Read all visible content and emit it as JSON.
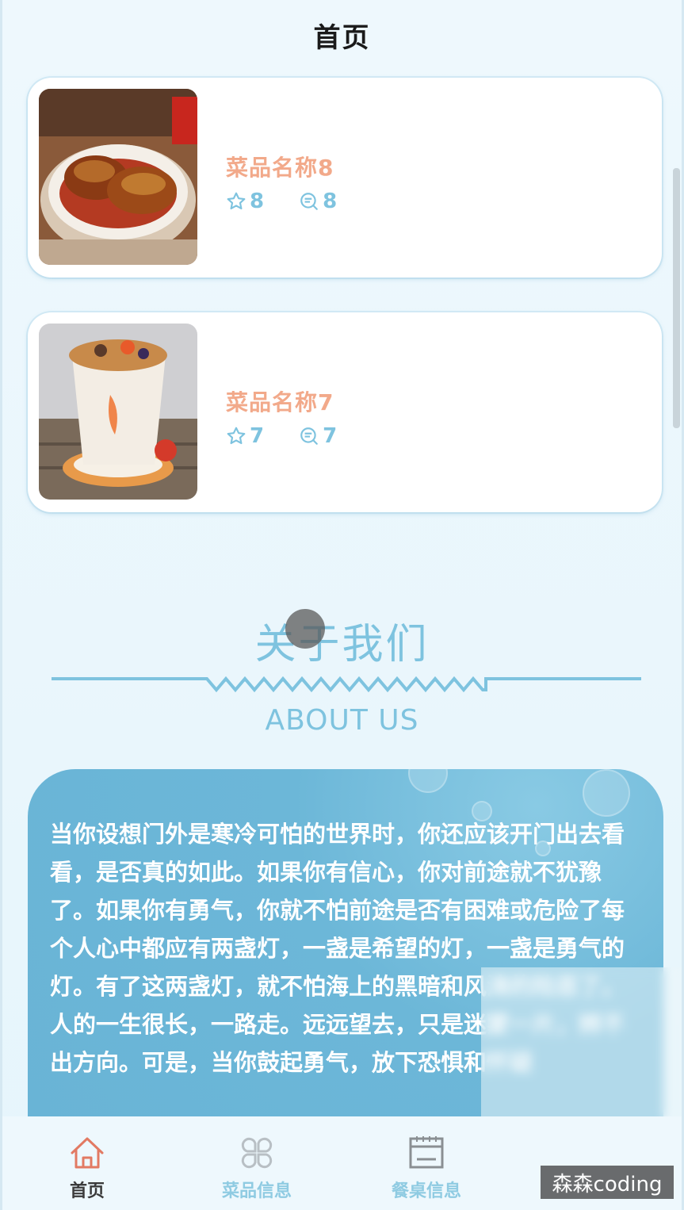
{
  "header": {
    "title": "首页"
  },
  "dishes": [
    {
      "name": "菜品名称8",
      "likes": "8",
      "comments": "8"
    },
    {
      "name": "菜品名称7",
      "likes": "7",
      "comments": "7"
    }
  ],
  "about": {
    "title": "关于我们",
    "subtitle": "ABOUT US",
    "text": "当你设想门外是寒冷可怕的世界时，你还应该开门出去看看，是否真的如此。如果你有信心，你对前途就不犹豫了。如果你有勇气，你就不怕前途是否有困难或危险了每个人心中都应有两盏灯，一盏是希望的灯，一盏是勇气的灯。有了这两盏灯，就不怕海上的黑暗和风涛的险恶了。人的一生很长，一路走。远远望去，只是迷蒙一片，辨不出方向。可是，当你鼓起勇气，放下恐惧和怀疑"
  },
  "tabbar": {
    "items": [
      {
        "label": "首页",
        "icon": "home-icon"
      },
      {
        "label": "菜品信息",
        "icon": "grid-icon"
      },
      {
        "label": "餐桌信息",
        "icon": "calendar-icon"
      }
    ]
  },
  "watermark": "森森coding",
  "colors": {
    "accent": "#7ec3df",
    "dish_name": "#f2a98a",
    "active_tab": "#e27a63"
  }
}
